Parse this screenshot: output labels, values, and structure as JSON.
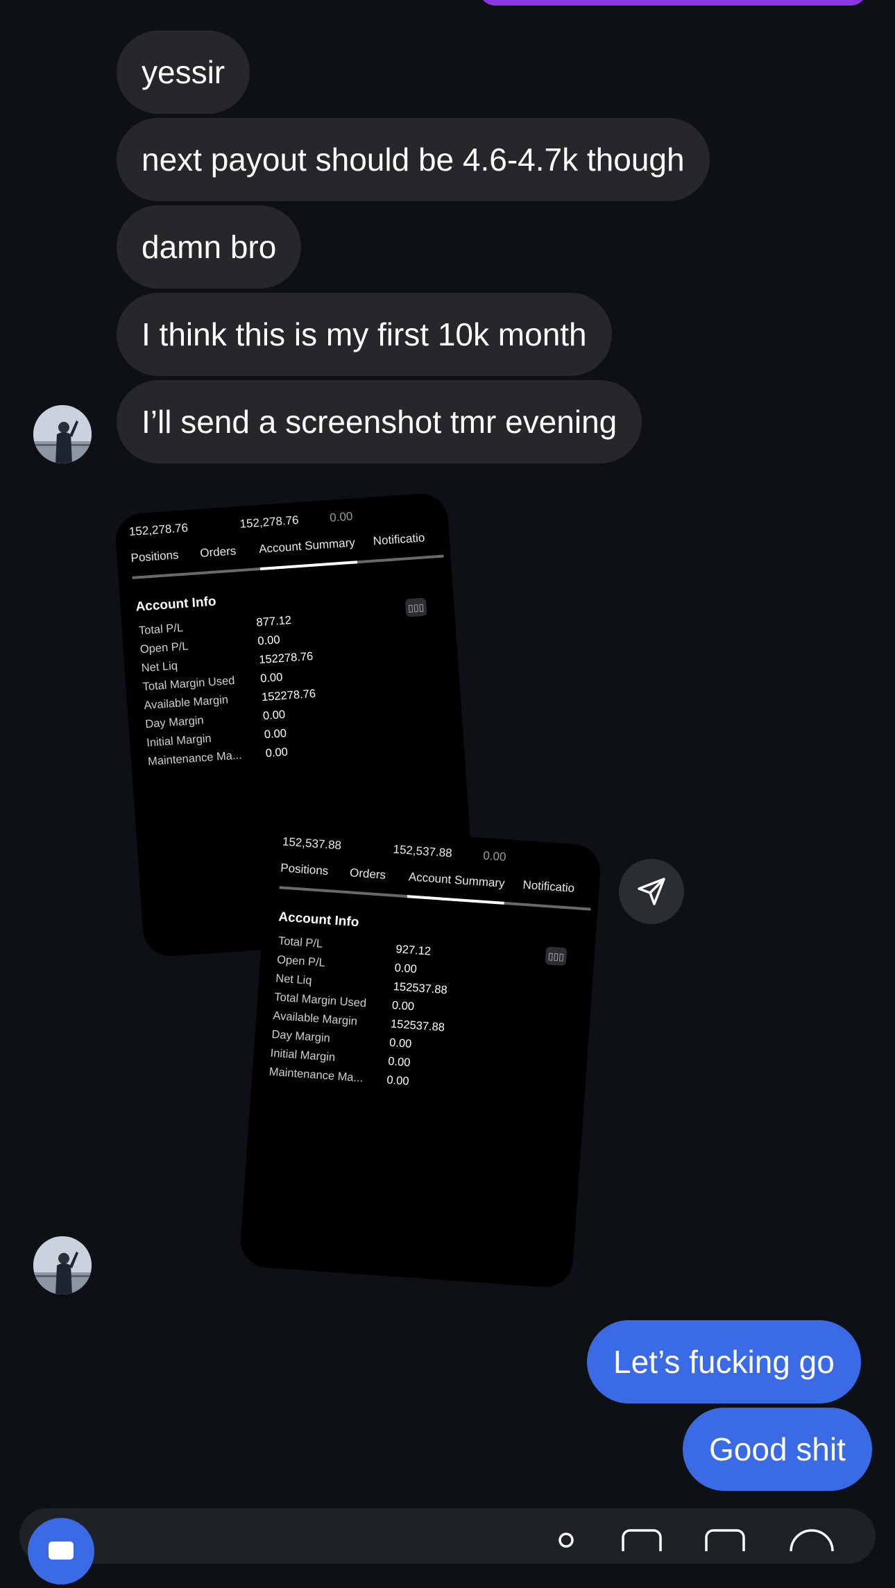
{
  "messages_in": [
    {
      "text": "yessir"
    },
    {
      "text": "next payout should be 4.6-4.7k though"
    },
    {
      "text": "damn bro"
    },
    {
      "text": "I think this is my first 10k month"
    },
    {
      "text": "I’ll send a screenshot tmr evening"
    }
  ],
  "messages_out": [
    {
      "text": "Let’s fucking go"
    },
    {
      "text": "Good shit"
    }
  ],
  "card1": {
    "header": [
      "152,278.76",
      "152,278.76",
      "0.00"
    ],
    "tabs": [
      "Positions",
      "Orders",
      "Account Summary",
      "Notificatio"
    ],
    "title": "Account Info",
    "rows": [
      {
        "k": "Total P/L",
        "v": "877.12"
      },
      {
        "k": "Open P/L",
        "v": "0.00"
      },
      {
        "k": "Net Liq",
        "v": "152278.76"
      },
      {
        "k": "Total Margin Used",
        "v": "0.00"
      },
      {
        "k": "Available Margin",
        "v": "152278.76"
      },
      {
        "k": "Day Margin",
        "v": "0.00"
      },
      {
        "k": "Initial Margin",
        "v": "0.00"
      },
      {
        "k": "Maintenance Ma...",
        "v": "0.00"
      }
    ]
  },
  "card2": {
    "header": [
      "152,537.88",
      "152,537.88",
      "0.00"
    ],
    "tabs": [
      "Positions",
      "Orders",
      "Account Summary",
      "Notificatio"
    ],
    "title": "Account Info",
    "rows": [
      {
        "k": "Total P/L",
        "v": "927.12"
      },
      {
        "k": "Open P/L",
        "v": "0.00"
      },
      {
        "k": "Net Liq",
        "v": "152537.88"
      },
      {
        "k": "Total Margin Used",
        "v": "0.00"
      },
      {
        "k": "Available Margin",
        "v": "152537.88"
      },
      {
        "k": "Day Margin",
        "v": "0.00"
      },
      {
        "k": "Initial Margin",
        "v": "0.00"
      },
      {
        "k": "Maintenance Ma...",
        "v": "0.00"
      }
    ]
  },
  "icons": {
    "share": "send-icon",
    "camera": "camera-icon"
  },
  "colors": {
    "background": "#0d1014",
    "incoming_bubble": "#25272b",
    "outgoing_bubble": "#3a6be5",
    "top_sent_bubble": "#8a36e6"
  }
}
